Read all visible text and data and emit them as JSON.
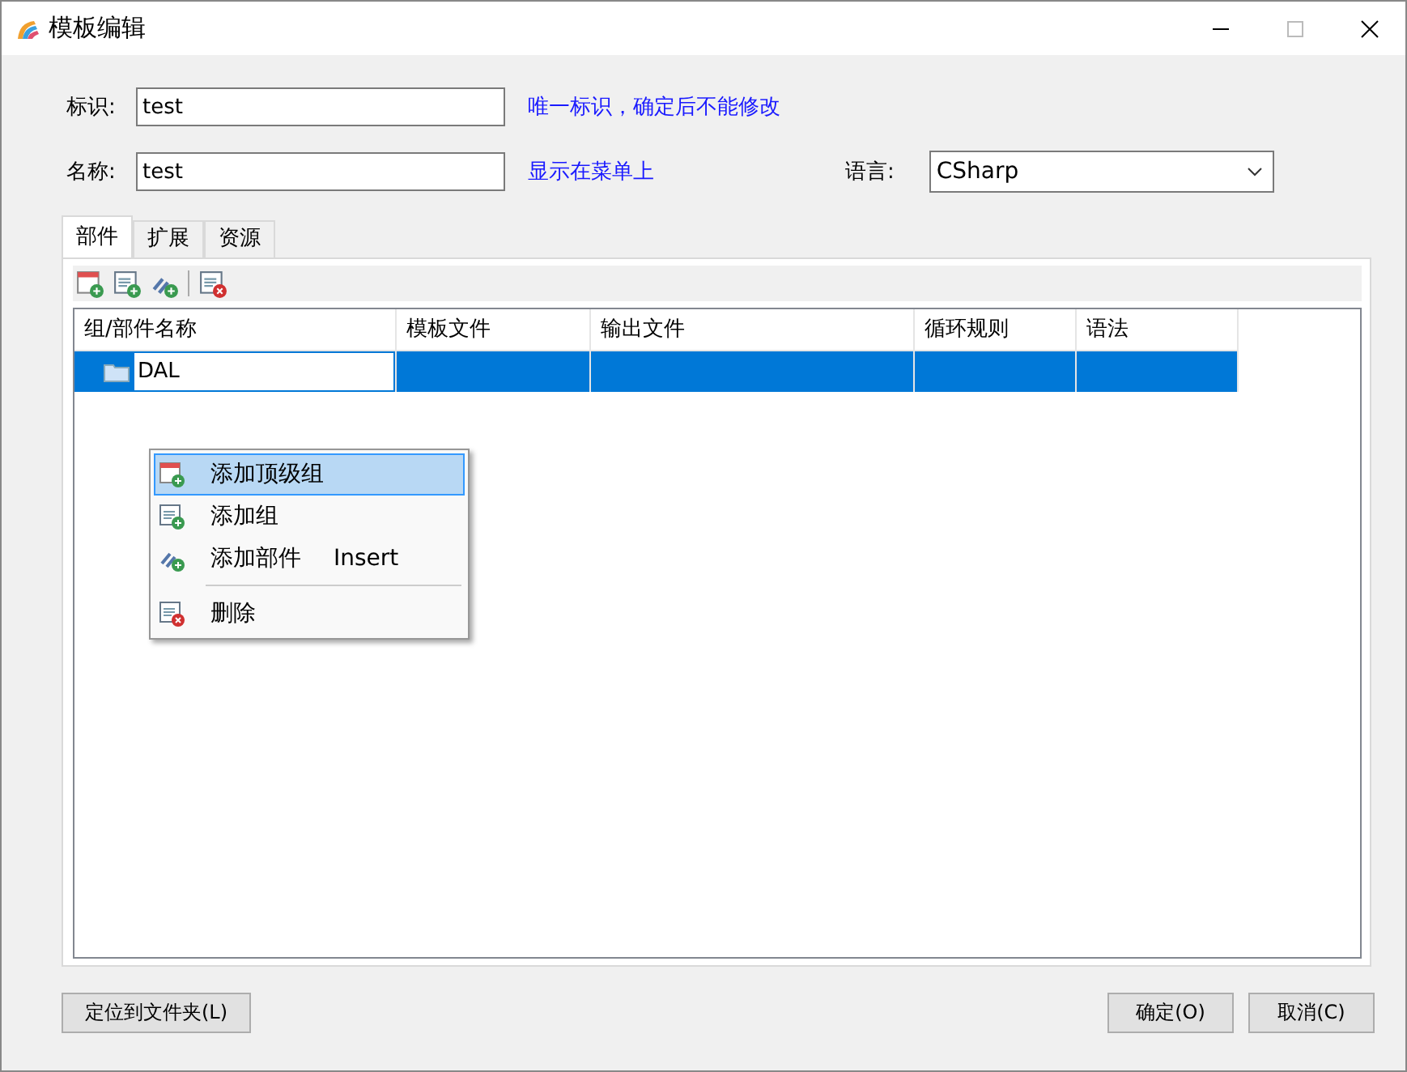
{
  "window": {
    "title": "模板编辑"
  },
  "fields": [
    {
      "label": "标识:",
      "value": "test",
      "hint": "唯一标识，确定后不能修改"
    },
    {
      "label": "名称:",
      "value": "test",
      "hint": "显示在菜单上"
    }
  ],
  "language": {
    "label": "语言:",
    "value": "CSharp"
  },
  "tabs": [
    {
      "label": "部件",
      "selected": true
    },
    {
      "label": "扩展",
      "selected": false
    },
    {
      "label": "资源",
      "selected": false
    }
  ],
  "toolbar": [
    {
      "kind": "add-top"
    },
    {
      "kind": "add-group"
    },
    {
      "kind": "add-part"
    },
    {
      "kind": "separator"
    },
    {
      "kind": "delete"
    }
  ],
  "table": {
    "columns": [
      "组/部件名称",
      "模板文件",
      "输出文件",
      "循环规则",
      "语法"
    ],
    "rows": [
      {
        "name": "DAL",
        "selected": true,
        "editing": true
      }
    ]
  },
  "context_menu": {
    "items": [
      {
        "kind": "add-top",
        "label": "添加顶级组",
        "selected": true
      },
      {
        "kind": "add-group",
        "label": "添加组",
        "selected": false
      },
      {
        "kind": "add-part",
        "label": "添加部件",
        "shortcut": "Insert",
        "selected": false
      },
      {
        "kind": "separator"
      },
      {
        "kind": "delete",
        "label": "删除",
        "selected": false
      }
    ]
  },
  "buttons_left": [
    "定位到文件夹(L)"
  ],
  "buttons_right": [
    "确定(O)",
    "取消(C)"
  ]
}
